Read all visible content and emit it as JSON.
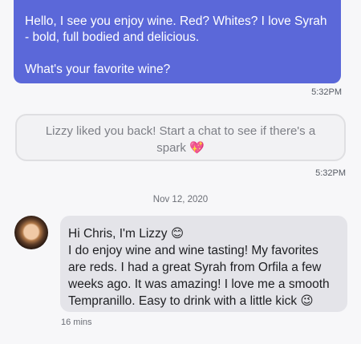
{
  "messages": {
    "outgoing": {
      "line1": "Hello, I see you enjoy wine. Red? Whites? I love Syrah - bold, full bodied and delicious.",
      "line2": "What's your favorite wine?",
      "time": "5:32PM"
    },
    "system": {
      "text": "Lizzy liked you back! Start a chat to see if there's a spark 💖",
      "time": "5:32PM"
    },
    "date_separator": "Nov 12, 2020",
    "incoming": {
      "line1": "Hi Chris, I'm Lizzy 😊",
      "line2": "I do enjoy wine and wine tasting! My favorites are reds. I had a great Syrah from Orfila a few weeks ago. It was amazing! I love me a smooth Tempranillo. Easy to drink with a little kick 😉",
      "age": "16 mins",
      "avatar": "avatar-photo"
    }
  },
  "colors": {
    "outgoing_bubble": "#5b68d9",
    "system_bubble": "#f2f2f4",
    "incoming_bubble": "#e4e4e9",
    "background": "#f7f7f9"
  }
}
